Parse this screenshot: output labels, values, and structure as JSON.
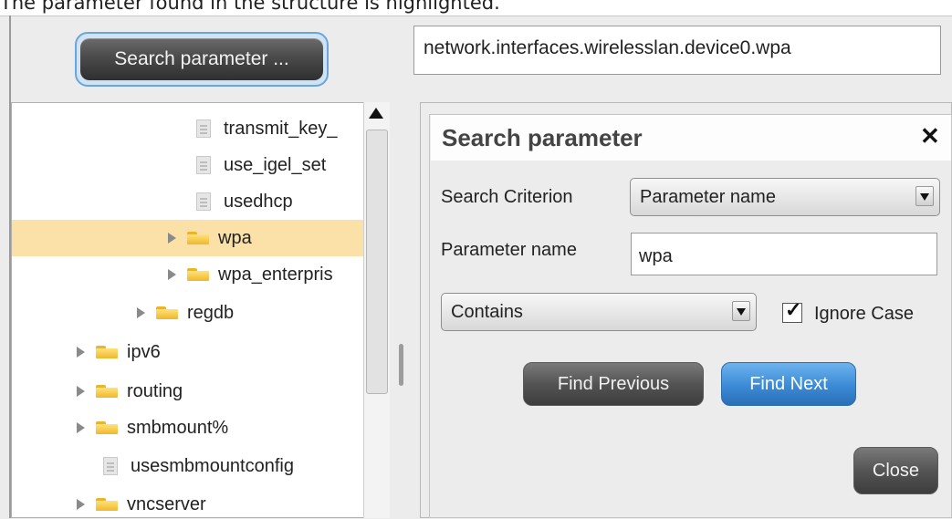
{
  "caption": "The parameter found in the structure is highlighted.",
  "toolbar": {
    "search_button_label": "Search parameter ..."
  },
  "path_field": {
    "value": "network.interfaces.wirelesslan.device0.wpa"
  },
  "tree": {
    "items": [
      {
        "label": "transmit_key_",
        "kind": "file",
        "level": 4,
        "selected": false
      },
      {
        "label": "use_igel_set",
        "kind": "file",
        "level": 4,
        "selected": false
      },
      {
        "label": "usedhcp",
        "kind": "file",
        "level": 4,
        "selected": false
      },
      {
        "label": "wpa",
        "kind": "folder",
        "level": 3,
        "selected": true
      },
      {
        "label": "wpa_enterpris",
        "kind": "folder",
        "level": 3,
        "selected": false
      },
      {
        "label": "regdb",
        "kind": "folder",
        "level": 2,
        "selected": false
      },
      {
        "label": "ipv6",
        "kind": "folder",
        "level": 1,
        "selected": false
      },
      {
        "label": "routing",
        "kind": "folder",
        "level": 1,
        "selected": false
      },
      {
        "label": "smbmount%",
        "kind": "folder",
        "level": 1,
        "selected": false
      },
      {
        "label": "usesmbmountconfig",
        "kind": "file",
        "level": 1,
        "selected": false
      },
      {
        "label": "vncserver",
        "kind": "folder",
        "level": 1,
        "selected": false
      }
    ]
  },
  "dialog": {
    "title": "Search parameter",
    "close_icon": "close-icon",
    "search_criterion_label": "Search Criterion",
    "search_criterion_value": "Parameter name",
    "parameter_name_label": "Parameter name",
    "parameter_name_value": "wpa",
    "match_mode_value": "Contains",
    "ignore_case_label": "Ignore Case",
    "ignore_case_checked": true,
    "find_previous_label": "Find Previous",
    "find_next_label": "Find Next",
    "close_label": "Close"
  },
  "colors": {
    "selection": "#fbe0a8",
    "primary_button": "#3b8ad6",
    "dark_button": "#545454",
    "folder": "#efb82b"
  }
}
